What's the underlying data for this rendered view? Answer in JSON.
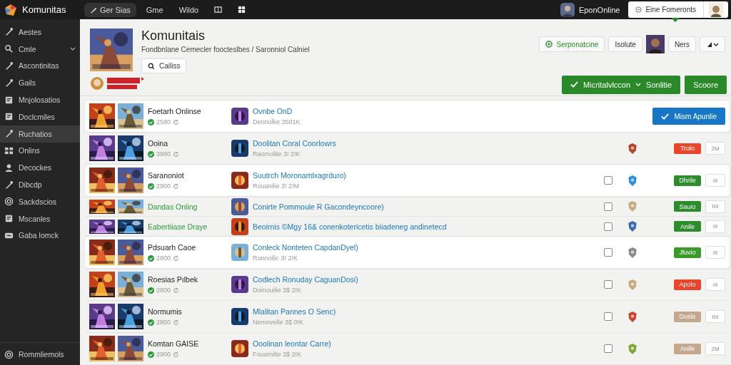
{
  "topbar": {
    "app_name": "Komunitas",
    "nav": [
      {
        "label": "Ger Sias",
        "selected": true
      },
      {
        "label": "Gme",
        "selected": false
      },
      {
        "label": "Wildo",
        "selected": false
      }
    ],
    "user": "EponOnline",
    "dropdown": "Eine Fomeronts"
  },
  "sidebar": {
    "items": [
      {
        "label": "Aestes",
        "selected": false
      },
      {
        "label": "Cmle",
        "selected": false,
        "expandable": true
      },
      {
        "label": "Ascontinitas",
        "selected": false
      },
      {
        "label": "Gails",
        "selected": false
      },
      {
        "label": "Mnjolosatios",
        "selected": false
      },
      {
        "label": "Doclcmiles",
        "selected": false
      },
      {
        "label": "Ruchatios",
        "selected": true
      },
      {
        "label": "Onlins",
        "selected": false
      },
      {
        "label": "Decockes",
        "selected": false
      },
      {
        "label": "Dibcdp",
        "selected": false
      },
      {
        "label": "Sackdscios",
        "selected": false
      },
      {
        "label": "Mscanles",
        "selected": false
      },
      {
        "label": "Gaba lomck",
        "selected": false
      }
    ],
    "footer": "Rommliemols"
  },
  "header": {
    "title": "Komunitais",
    "subtitle": "Fondbnlane Cemecler foocteslbes / Saronniol Calniel",
    "search_button": "Cailiss",
    "actions": [
      {
        "kind": "status",
        "label": "Serponatcine"
      },
      {
        "kind": "plain",
        "label": "Isolute"
      },
      {
        "kind": "avatar"
      },
      {
        "kind": "plain",
        "label": "Ners"
      },
      {
        "kind": "sort"
      }
    ],
    "primary_button": {
      "label": "Micritalvlccon",
      "sub": "Sonlitie"
    },
    "secondary_button": "Scoore"
  },
  "rows": [
    {
      "kind": "game",
      "selected": true,
      "name": "Foetarh Onlinse",
      "stat": "2580",
      "link": "Ovnbe OnD",
      "sub": "Dennolke 3501K",
      "action": "Mism Apunlie"
    },
    {
      "kind": "game",
      "selected": false,
      "name": "Ooina",
      "stat": "3980",
      "link": "Doolitan Coral Coorlowrs",
      "sub": "Raomolite 3! 2!K",
      "shield": {
        "color": "#b5432c"
      },
      "status": {
        "label": "Trolo",
        "color": "#e8452c"
      },
      "count": "2M"
    },
    {
      "kind": "game",
      "selected": true,
      "name": "Saranoniot",
      "stat": "2900",
      "link": "Suutrch Moronamlxagrduro)",
      "sub": "Rouanilie 3! 2!M",
      "checked": false,
      "shield": {
        "color": "#2a8fd6"
      },
      "status": {
        "label": "Dhrile",
        "color": "#2e8b2e"
      },
      "count": "III"
    },
    {
      "kind": "compact",
      "selected": false,
      "name": "Dandas Onling",
      "link": "Conirte Pommoule R Gacondeyncoore)",
      "checked": false,
      "shield": {
        "color": "#c8a880"
      },
      "status": {
        "label": "Sauio",
        "color": "#2e8b2e"
      },
      "count": "IIII"
    },
    {
      "kind": "compact",
      "selected": false,
      "name": "Eabertiiase Draye",
      "link": "Beoirnis ©Mgy 16& conenkotericetis biiadeneg andinetecd",
      "checked": false,
      "shield": {
        "color": "#3d6aa8"
      },
      "status": {
        "label": "Anile",
        "color": "#2e8b2e"
      },
      "count": "III"
    },
    {
      "kind": "game",
      "selected": true,
      "name": "Pdsuarh Caoe",
      "stat": "2800",
      "link": "Conleck Nonteten CapdanDyel)",
      "sub": "Ronnoilic 3! 2!K",
      "checked": false,
      "shield": {
        "color": "#8a8a8a"
      },
      "status": {
        "label": "Jluvio",
        "color": "#3a9a2a"
      },
      "count": "III"
    },
    {
      "kind": "game",
      "selected": false,
      "name": "Roesias Pılbek",
      "stat": "2800",
      "link": "Codlech Ronuday CaguanDosi)",
      "sub": "Doinouilie 3$ 2!K",
      "checked": false,
      "shield": {
        "color": "#c8a880"
      },
      "status": {
        "label": "Apolo",
        "color": "#e8452c"
      },
      "count": "III"
    },
    {
      "kind": "game",
      "selected": false,
      "name": "Normumis",
      "stat": "2800",
      "link": "Mlalitan Pannes O Senc)",
      "sub": "Nemnvelle 3$ 0!K",
      "checked": false,
      "shield": {
        "color": "#c5452c"
      },
      "status": {
        "label": "Dosle",
        "color": "#c4a88e"
      },
      "count": "IIII"
    },
    {
      "kind": "game",
      "selected": false,
      "name": "Komtan GAISE",
      "stat": "2900",
      "link": "Ooolinan leontar Carre)",
      "sub": "Fouamilte 3$ 2!K",
      "checked": false,
      "shield": {
        "color": "#7aa83a"
      },
      "status": {
        "label": "Anile",
        "color": "#c4a88e"
      },
      "count": "2M"
    }
  ]
}
